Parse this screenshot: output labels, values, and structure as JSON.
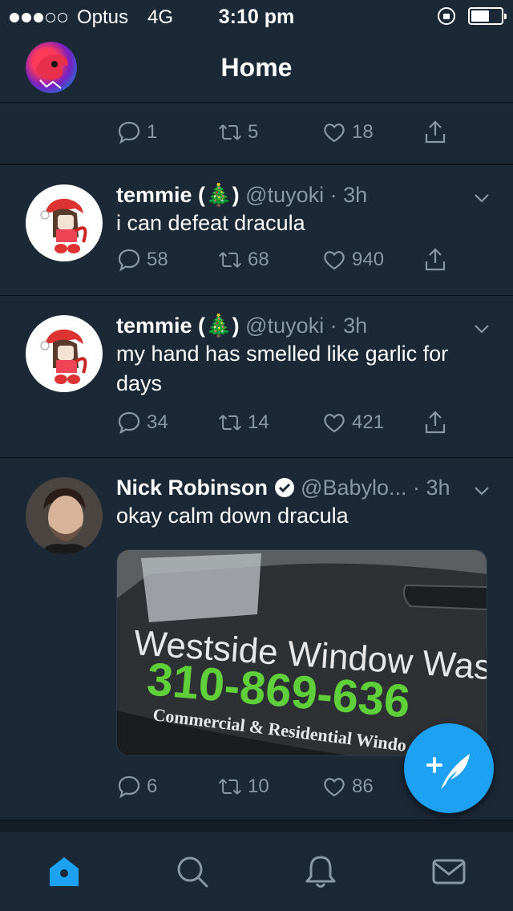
{
  "status_bar": {
    "carrier": "Optus",
    "network": "4G",
    "time": "3:10 pm",
    "signal_bars": 3,
    "signal_total": 5,
    "battery_level": 0.6
  },
  "nav": {
    "title": "Home",
    "avatar_icon": "profile-avatar"
  },
  "tweets": [
    {
      "replies": "1",
      "retweets": "5",
      "likes": "18"
    },
    {
      "name": "temmie (🎄)",
      "handle": "@tuyoki",
      "time": "· 3h",
      "text": "i can defeat dracula",
      "replies": "58",
      "retweets": "68",
      "likes": "940"
    },
    {
      "name": "temmie (🎄)",
      "handle": "@tuyoki",
      "time": "· 3h",
      "text": "my hand has smelled like garlic for days",
      "replies": "34",
      "retweets": "14",
      "likes": "421"
    },
    {
      "name": "Nick Robinson",
      "verified": true,
      "handle": "@Babylo...",
      "time": "· 3h",
      "text": "okay calm down dracula",
      "image_text": {
        "line1": "Westside Window Washers.",
        "line2": "310-869-636",
        "line3": "Commercial & Residential Windo"
      },
      "replies": "6",
      "retweets": "10",
      "likes": "86"
    }
  ],
  "tab_bar": {
    "tabs": [
      "home-icon",
      "search-icon",
      "notifications-icon",
      "messages-icon"
    ],
    "active": "home-icon"
  },
  "compose_button": "compose-tweet-icon",
  "colors": {
    "background": "#141d26",
    "card": "#1b2836",
    "accent": "#1da1f2",
    "muted": "#8899a6"
  }
}
